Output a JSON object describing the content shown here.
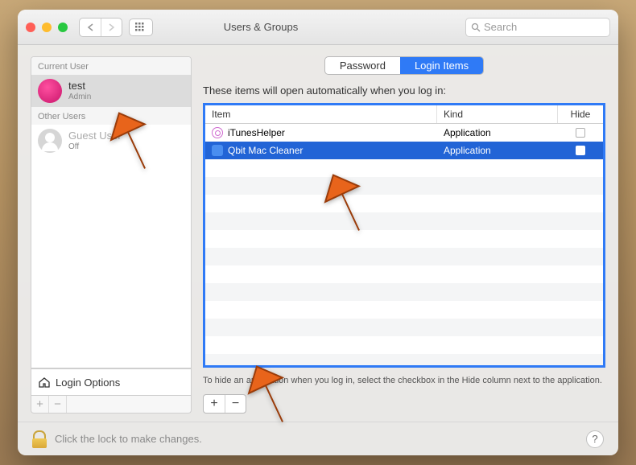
{
  "window_title": "Users & Groups",
  "search": {
    "placeholder": "Search"
  },
  "sidebar": {
    "current_user_header": "Current User",
    "other_users_header": "Other Users",
    "users": [
      {
        "name": "test",
        "role": "Admin"
      },
      {
        "name": "Guest User",
        "role": "Off"
      }
    ],
    "login_options_label": "Login Options"
  },
  "tabs": {
    "password": "Password",
    "login_items": "Login Items"
  },
  "main": {
    "intro": "These items will open automatically when you log in:",
    "columns": {
      "item": "Item",
      "kind": "Kind",
      "hide": "Hide"
    },
    "rows": [
      {
        "name": "iTunesHelper",
        "kind": "Application"
      },
      {
        "name": "Qbit Mac Cleaner",
        "kind": "Application"
      }
    ],
    "hint": "To hide an application when you log in, select the checkbox in the Hide column next to the application.",
    "plus": "+",
    "minus": "−"
  },
  "footer": {
    "lock_text": "Click the lock to make changes.",
    "help": "?"
  }
}
